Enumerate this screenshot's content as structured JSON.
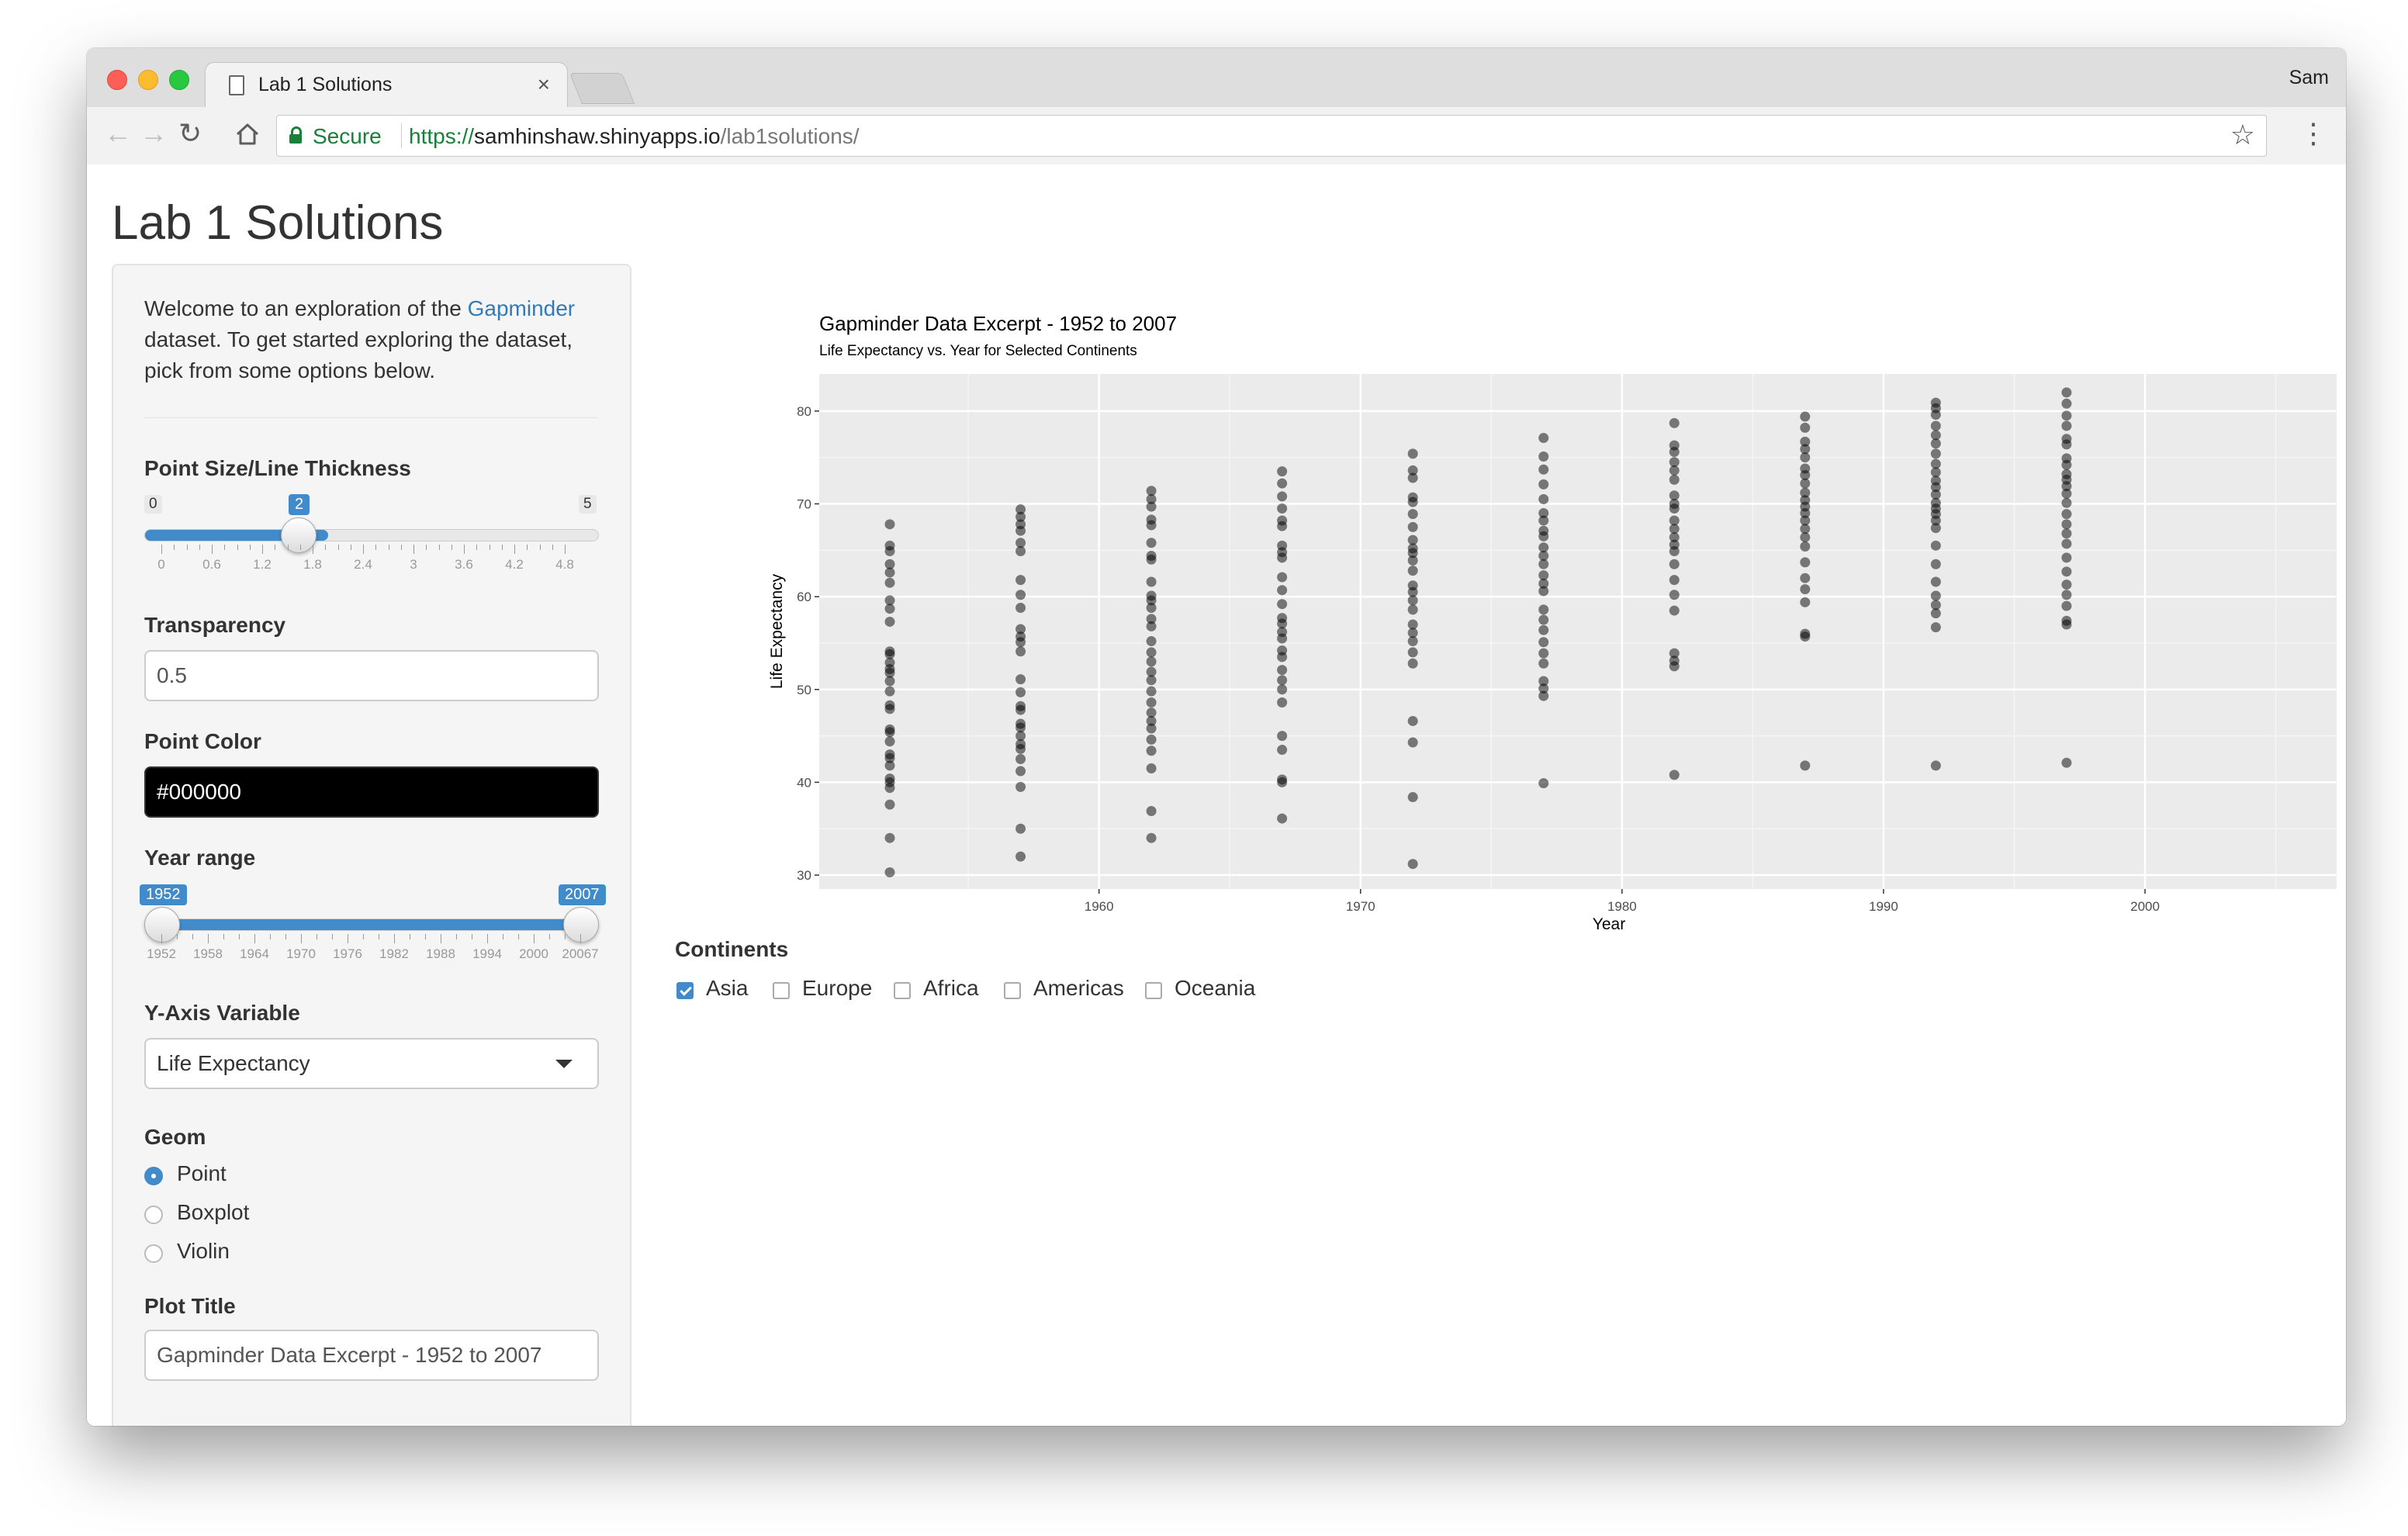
{
  "browser": {
    "tab_title": "Lab 1 Solutions",
    "tab_close": "×",
    "user": "Sam",
    "secure_label": "Secure",
    "url_scheme": "https://",
    "url_host": "samhinshaw.shinyapps.io",
    "url_path": "/lab1solutions/",
    "icons": [
      "back-icon",
      "forward-icon",
      "reload-icon",
      "home-icon",
      "lock-icon",
      "star-icon",
      "menu-icon"
    ]
  },
  "page": {
    "title": "Lab 1 Solutions"
  },
  "sidebar": {
    "welcome_before": "Welcome to an exploration of the ",
    "welcome_link": "Gapminder",
    "welcome_after": " dataset. To get started exploring the dataset, pick from some options below.",
    "point_size": {
      "label": "Point Size/Line Thickness",
      "min": "0",
      "max": "5",
      "value": "2",
      "ticks": [
        "0",
        "0.6",
        "1.2",
        "1.8",
        "2.4",
        "3",
        "3.6",
        "4.2",
        "4.8"
      ]
    },
    "transparency": {
      "label": "Transparency",
      "value": "0.5"
    },
    "point_color": {
      "label": "Point Color",
      "value": "#000000"
    },
    "year_range": {
      "label": "Year range",
      "from": "1952",
      "to": "2007",
      "ticks": [
        "1952",
        "1958",
        "1964",
        "1970",
        "1976",
        "1982",
        "1988",
        "1994",
        "2000",
        "20067"
      ]
    },
    "y_axis": {
      "label": "Y-Axis Variable",
      "value": "Life Expectancy"
    },
    "geom": {
      "label": "Geom",
      "options": [
        "Point",
        "Boxplot",
        "Violin"
      ],
      "selected": "Point"
    },
    "plot_title": {
      "label": "Plot Title",
      "value": "Gapminder Data Excerpt - 1952 to 2007"
    }
  },
  "continents": {
    "label": "Continents",
    "options": [
      {
        "name": "Asia",
        "checked": true
      },
      {
        "name": "Europe",
        "checked": false
      },
      {
        "name": "Africa",
        "checked": false
      },
      {
        "name": "Americas",
        "checked": false
      },
      {
        "name": "Oceania",
        "checked": false
      }
    ]
  },
  "colors": {
    "accent": "#428bca",
    "secure_green": "#188038",
    "panel_bg": "#ebebeb",
    "point": "#000000"
  },
  "chart_data": {
    "type": "scatter",
    "title": "Gapminder Data Excerpt - 1952 to 2007",
    "subtitle": "Life Expectancy vs. Year for Selected Continents",
    "xlabel": "Year",
    "ylabel": "Life Expectancy",
    "xlim": [
      1949.3,
      2009.7
    ],
    "ylim": [
      28.5,
      84
    ],
    "xticks": [
      1960,
      1970,
      1980,
      1990,
      2000
    ],
    "yticks": [
      30,
      40,
      50,
      60,
      70,
      80
    ],
    "grid": true,
    "alpha": 0.5,
    "columns": [
      {
        "x": 1952,
        "y": [
          30.3,
          34.0,
          37.6,
          39.4,
          40.0,
          40.4,
          41.8,
          42.6,
          43.0,
          44.4,
          45.4,
          45.7,
          47.9,
          48.3,
          49.8,
          50.9,
          51.8,
          52.2,
          52.9,
          53.8,
          54.1,
          57.3,
          58.7,
          59.6,
          61.5,
          62.6,
          63.5,
          64.9,
          65.5,
          67.8
        ]
      },
      {
        "x": 1957,
        "y": [
          32.0,
          35.0,
          39.5,
          41.2,
          42.5,
          43.6,
          44.1,
          45.0,
          45.9,
          46.3,
          47.8,
          48.2,
          49.7,
          51.1,
          54.1,
          55.1,
          55.7,
          56.5,
          58.8,
          60.2,
          61.8,
          64.9,
          65.8,
          67.1,
          67.8,
          68.6,
          69.4
        ]
      },
      {
        "x": 1962,
        "y": [
          34.0,
          36.9,
          41.5,
          43.4,
          44.6,
          45.8,
          46.6,
          47.5,
          48.6,
          49.8,
          51.0,
          51.9,
          53.0,
          54.0,
          55.2,
          56.8,
          57.6,
          58.8,
          59.6,
          60.1,
          61.6,
          64.0,
          64.4,
          65.8,
          67.7,
          68.3,
          69.7,
          70.5,
          71.4
        ]
      },
      {
        "x": 1967,
        "y": [
          36.1,
          40.0,
          40.3,
          43.5,
          45.0,
          48.6,
          50.0,
          51.0,
          52.1,
          53.5,
          54.2,
          55.5,
          56.2,
          57.1,
          57.7,
          59.2,
          60.7,
          62.1,
          64.2,
          64.8,
          65.5,
          67.6,
          68.2,
          69.5,
          70.8,
          72.2,
          73.5
        ]
      },
      {
        "x": 1972,
        "y": [
          31.2,
          38.4,
          44.3,
          46.6,
          52.8,
          54.0,
          55.2,
          56.1,
          57.0,
          58.6,
          59.6,
          60.5,
          61.2,
          62.8,
          63.9,
          64.7,
          65.2,
          66.1,
          67.5,
          68.9,
          70.2,
          70.7,
          72.8,
          73.6,
          75.4
        ]
      },
      {
        "x": 1977,
        "y": [
          39.9,
          49.3,
          50.1,
          50.9,
          52.8,
          53.9,
          55.1,
          56.4,
          57.5,
          58.6,
          60.6,
          61.4,
          62.3,
          63.5,
          64.4,
          65.3,
          66.5,
          67.1,
          68.2,
          69.0,
          70.5,
          72.1,
          73.7,
          75.1,
          77.1
        ]
      },
      {
        "x": 1982,
        "y": [
          40.8,
          52.5,
          53.1,
          53.9,
          58.5,
          60.2,
          61.8,
          63.5,
          64.9,
          65.6,
          66.4,
          67.3,
          68.2,
          69.5,
          70.0,
          70.9,
          72.6,
          73.6,
          74.5,
          75.6,
          76.3,
          78.7
        ]
      },
      {
        "x": 1987,
        "y": [
          41.8,
          55.7,
          56.0,
          59.4,
          60.8,
          62.0,
          63.7,
          65.4,
          66.4,
          67.3,
          68.2,
          69.0,
          69.7,
          70.4,
          71.2,
          72.2,
          73.1,
          73.8,
          75.0,
          75.9,
          76.7,
          78.2,
          79.4
        ]
      },
      {
        "x": 1992,
        "y": [
          41.8,
          56.7,
          58.2,
          59.1,
          60.1,
          61.6,
          63.5,
          65.5,
          67.4,
          68.2,
          68.9,
          69.5,
          70.1,
          71.0,
          71.8,
          72.5,
          73.4,
          74.3,
          75.4,
          76.5,
          77.4,
          78.4,
          79.6,
          80.3,
          80.9
        ]
      },
      {
        "x": 1997,
        "y": [
          42.1,
          57.0,
          57.4,
          59.0,
          60.2,
          61.3,
          62.7,
          64.2,
          65.7,
          66.8,
          67.8,
          68.9,
          70.1,
          71.1,
          71.9,
          72.6,
          73.2,
          74.2,
          74.9,
          76.4,
          77.0,
          78.4,
          79.5,
          80.8,
          82.0
        ]
      }
    ]
  }
}
